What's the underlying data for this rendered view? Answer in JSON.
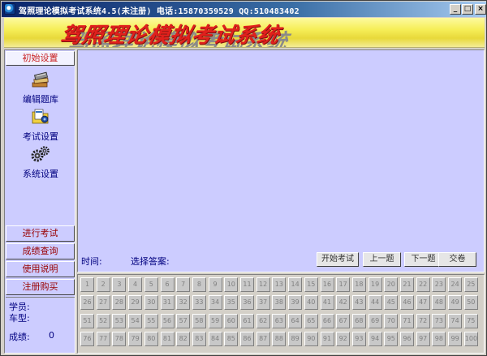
{
  "window": {
    "title": "驾照理论模拟考试系统4.5(未注册) 电话:15870359529 QQ:510483402",
    "controls": [
      "_",
      "□",
      "×"
    ]
  },
  "banner": {
    "title": "驾照理论模拟考试系统"
  },
  "sidebar": {
    "init_label": "初始设置",
    "tools": [
      {
        "label": "编辑题库",
        "icon": "book-stack-icon"
      },
      {
        "label": "考试设置",
        "icon": "folder-settings-icon"
      },
      {
        "label": "系统设置",
        "icon": "gears-icon"
      }
    ],
    "buttons": [
      "进行考试",
      "成绩查询",
      "使用说明",
      "注册购买"
    ],
    "student_label": "学员:",
    "cartype_label": "车型:",
    "score_label": "成绩:",
    "score_value": "0"
  },
  "main": {
    "time_label": "时间:",
    "answer_label": "选择答案:",
    "begin_label": "开始考试",
    "prev_label": "上一题",
    "next_label": "下一题",
    "submit_label": "交卷"
  },
  "question_grid": {
    "numbers": [
      1,
      2,
      3,
      4,
      5,
      6,
      7,
      8,
      9,
      10,
      11,
      12,
      13,
      14,
      15,
      16,
      17,
      18,
      19,
      20,
      21,
      22,
      23,
      24,
      25,
      26,
      27,
      28,
      29,
      30,
      31,
      32,
      33,
      34,
      35,
      36,
      37,
      38,
      39,
      40,
      41,
      42,
      43,
      44,
      45,
      46,
      47,
      48,
      49,
      50,
      51,
      52,
      53,
      54,
      55,
      56,
      57,
      58,
      59,
      60,
      61,
      62,
      63,
      64,
      65,
      66,
      67,
      68,
      69,
      70,
      71,
      72,
      73,
      74,
      75,
      76,
      77,
      78,
      79,
      80,
      81,
      82,
      83,
      84,
      85,
      86,
      87,
      88,
      89,
      90,
      91,
      92,
      93,
      94,
      95,
      96,
      97,
      98,
      99,
      100
    ]
  },
  "colors": {
    "panel": "#ccccff",
    "banner_text": "#e0201c",
    "button_text": "#990000",
    "label_text": "#00007f"
  }
}
